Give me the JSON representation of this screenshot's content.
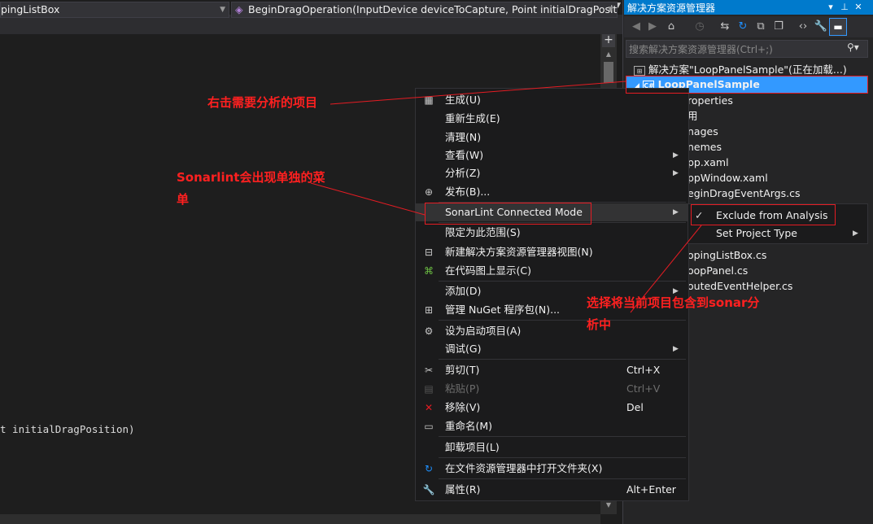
{
  "editor": {
    "type_dropdown": "pingListBox",
    "member_dropdown": "BeginDragOperation(InputDevice deviceToCapture, Point initialDragPosition",
    "code_fragment": "t initialDragPosition)",
    "split_icon": "split-plus-icon"
  },
  "solution_explorer": {
    "title": "解决方案资源管理器",
    "title_buttons": [
      "dropdown",
      "pin",
      "close"
    ],
    "toolbar": [
      "back-icon",
      "forward-icon",
      "home-icon",
      "history-icon",
      "sync-icon",
      "refresh-icon",
      "collapse-icon",
      "copy-icon",
      "code-icon",
      "wrench-icon",
      "minus-icon"
    ],
    "search_placeholder": "搜索解决方案资源管理器(Ctrl+;)",
    "solution_label": "解决方案\"LoopPanelSample\"(正在加载...)",
    "project_label": "LoopPanelSample",
    "items": [
      "roperties",
      "用",
      "nages",
      "nemes",
      "pp.xaml",
      "ppWindow.xaml",
      "eginDragEventArgs.cs",
      "opingListBox.cs",
      "oopPanel.cs",
      "outedEventHelper.cs"
    ]
  },
  "context_menu": {
    "items": [
      {
        "label": "生成(U)",
        "icon": "build-icon"
      },
      {
        "label": "重新生成(E)"
      },
      {
        "label": "清理(N)"
      },
      {
        "label": "查看(W)",
        "submenu": true
      },
      {
        "label": "分析(Z)",
        "submenu": true
      },
      {
        "label": "发布(B)...",
        "icon": "globe-icon"
      },
      {
        "label": "SonarLint Connected Mode",
        "submenu": true
      },
      {
        "label": "限定为此范围(S)"
      },
      {
        "label": "新建解决方案资源管理器视图(N)",
        "icon": "new-view-icon"
      },
      {
        "label": "在代码图上显示(C)",
        "icon": "codemap-icon"
      },
      {
        "label": "添加(D)",
        "submenu": true
      },
      {
        "label": "管理 NuGet 程序包(N)...",
        "icon": "nuget-icon"
      },
      {
        "label": "设为启动项目(A)",
        "icon": "gear-icon"
      },
      {
        "label": "调试(G)",
        "submenu": true
      },
      {
        "label": "剪切(T)",
        "icon": "scissors-icon",
        "shortcut": "Ctrl+X"
      },
      {
        "label": "粘贴(P)",
        "icon": "paste-icon",
        "shortcut": "Ctrl+V",
        "disabled": true
      },
      {
        "label": "移除(V)",
        "icon": "delete-icon",
        "shortcut": "Del"
      },
      {
        "label": "重命名(M)",
        "icon": "rename-icon"
      },
      {
        "label": "卸载项目(L)"
      },
      {
        "label": "在文件资源管理器中打开文件夹(X)",
        "icon": "refresh-arrow-icon"
      },
      {
        "label": "属性(R)",
        "icon": "wrench-icon",
        "shortcut": "Alt+Enter"
      }
    ]
  },
  "submenu": {
    "items": [
      {
        "label": "Exclude from Analysis",
        "checked": true
      },
      {
        "label": "Set Project Type",
        "submenu": true
      }
    ]
  },
  "annotations": {
    "note1": "右击需要分析的项目",
    "note2_line1": "Sonarlint会出现单独的菜",
    "note2_line2": "单",
    "note3_line1": "选择将当前项目包含到sonar分",
    "note3_line2": "析中"
  },
  "colors": {
    "accent": "#007acc",
    "selection": "#3399ff",
    "annotation_red": "#e51c23",
    "menu_bg": "#1b1b1c",
    "editor_bg": "#1e1e1e"
  }
}
